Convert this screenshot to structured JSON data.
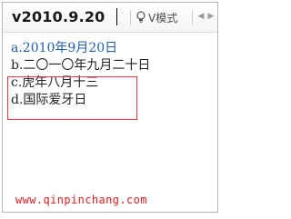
{
  "input": {
    "composition": "v2010.9.20",
    "mode_label": "V模式"
  },
  "candidates": [
    {
      "index": "a.",
      "text": "2010年9月20日"
    },
    {
      "index": "b.",
      "text": "二〇一〇年九月二十日"
    },
    {
      "index": "c.",
      "text": "虎年八月十三"
    },
    {
      "index": "d.",
      "text": "国际爱牙日"
    }
  ],
  "watermark": "www.qinpinchang.com",
  "colors": {
    "first_candidate": "#1f5ca8",
    "highlight_border": "#e33a3a",
    "watermark": "#e02020"
  },
  "icons": {
    "mode": "lightbulb-icon",
    "prev": "chevron-left-icon",
    "next": "chevron-right-icon"
  }
}
